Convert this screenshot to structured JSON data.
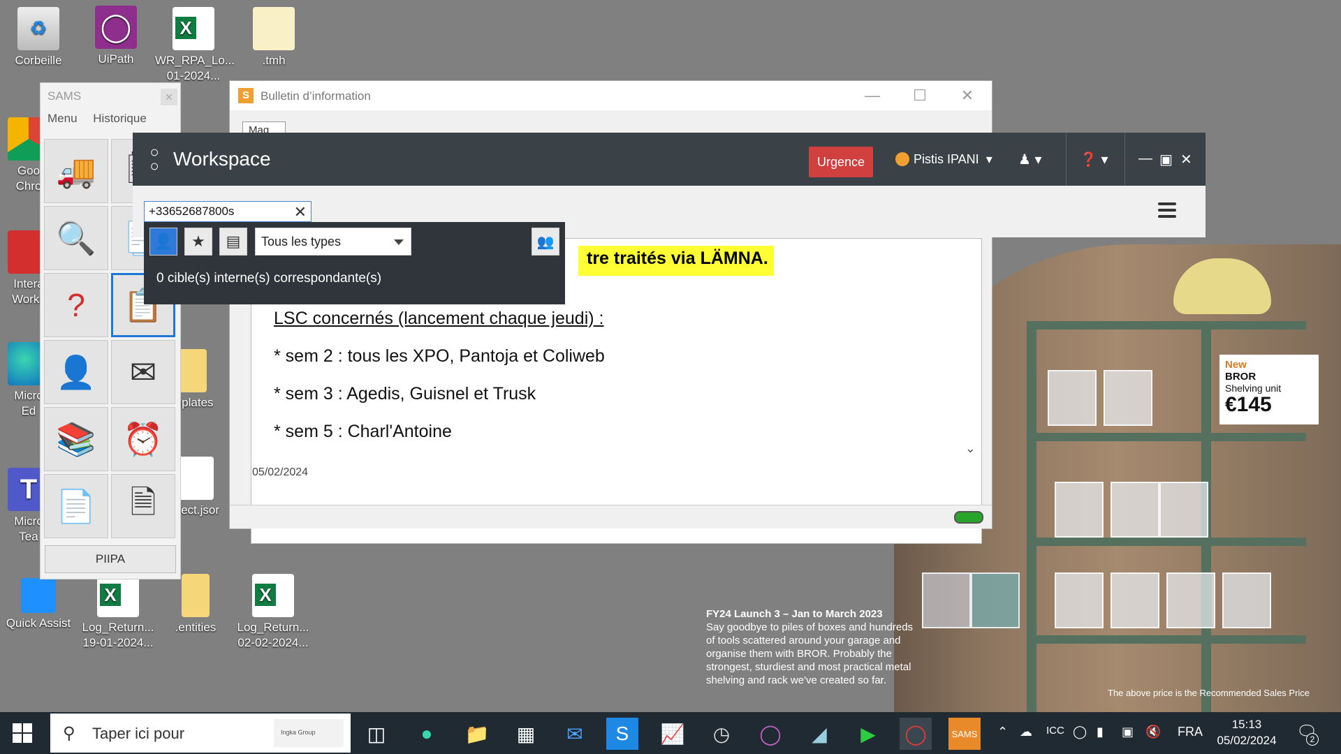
{
  "desktop_icons": {
    "recycle_bin": "Corbeille",
    "uipath": "UiPath",
    "wr_rpa": "WR_RPA_Lo...",
    "wr_rpa_line2": "01-2024...",
    "tmh": ".tmh",
    "chrome_1": "Goo",
    "chrome_2": "Chro",
    "interact_1": "Intera",
    "interact_2": "Works",
    "edge_1": "Micro",
    "edge_2": "Ed",
    "teams_1": "Micro",
    "teams_2": "Tea",
    "templates": "mplates",
    "project_json": "oject.jsor",
    "quick_assist": "Quick Assist",
    "log_return_1_a": "Log_Return...",
    "log_return_1_b": "19-01-2024...",
    "entities": ".entities",
    "log_return_2_a": "Log_Return...",
    "log_return_2_b": "02-02-2024..."
  },
  "sams": {
    "title": "SAMS",
    "menu": [
      "Menu",
      "Historique"
    ],
    "footer_button": "PIIPA"
  },
  "bulletin": {
    "title": "Bulletin d’information",
    "tab_label": "Mag",
    "highlight_text": "tre traités via LÄMNA.",
    "lines": [
      "LSC concernés (lancement chaque jeudi) :",
      "* sem 2 : tous les XPO, Pantoja et Coliweb",
      "* sem 3 : Agedis, Guisnel et Trusk",
      "* sem 5 : Charl'Antoine"
    ],
    "date": "05/02/2024"
  },
  "workspace": {
    "title": "Workspace",
    "urgence_label": "Urgence",
    "user_name": "Pistis IPANI",
    "search_value": "+33652687800s",
    "type_select": "Tous les types",
    "result_text": "0 cible(s) interne(s) correspondante(s)"
  },
  "ad": {
    "price_new": "New",
    "price_product": "BROR",
    "price_desc": "Shelving unit",
    "price_value": "€145",
    "headline": "FY24 Launch 3 – Jan to March 2023",
    "body": "Say goodbye to piles of boxes and hundreds of tools scattered around your garage and organise them with BROR. Probably the strongest, sturdiest and most practical metal shelving and rack we've created so far.",
    "footnote": "The above price is the Recommended Sales Price"
  },
  "taskbar": {
    "search_placeholder": "Taper ici pour",
    "search_badge": "Ingka Group",
    "language": "FRA",
    "time": "15:13",
    "date": "05/02/2024",
    "notification_count": "2",
    "tray_icc": "ICC"
  }
}
